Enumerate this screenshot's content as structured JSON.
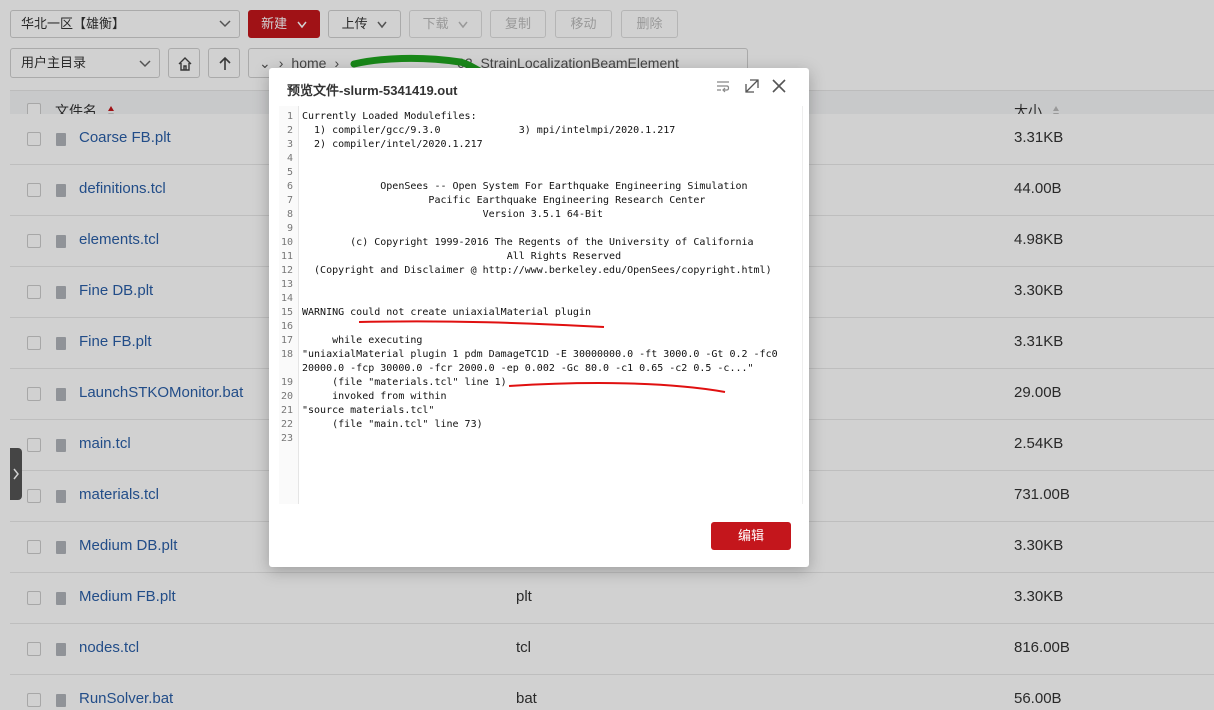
{
  "toolbar": {
    "region": "华北一区【雄衡】",
    "new_label": "新建",
    "upload_label": "上传",
    "download_label": "下载",
    "copy_label": "复制",
    "move_label": "移动",
    "delete_label": "删除",
    "dir_select": "用户主目录",
    "path_parts": [
      "home",
      "02_StrainLocalizationBeamElement"
    ]
  },
  "table": {
    "headers": {
      "name": "文件名",
      "size": "大小"
    },
    "rows": [
      {
        "name": "Coarse FB.plt",
        "type": "",
        "size": "3.31KB"
      },
      {
        "name": "definitions.tcl",
        "type": "",
        "size": "44.00B"
      },
      {
        "name": "elements.tcl",
        "type": "",
        "size": "4.98KB"
      },
      {
        "name": "Fine DB.plt",
        "type": "",
        "size": "3.30KB"
      },
      {
        "name": "Fine FB.plt",
        "type": "",
        "size": "3.31KB"
      },
      {
        "name": "LaunchSTKOMonitor.bat",
        "type": "",
        "size": "29.00B"
      },
      {
        "name": "main.tcl",
        "type": "",
        "size": "2.54KB"
      },
      {
        "name": "materials.tcl",
        "type": "",
        "size": "731.00B"
      },
      {
        "name": "Medium DB.plt",
        "type": "",
        "size": "3.30KB"
      },
      {
        "name": "Medium FB.plt",
        "type": "plt",
        "size": "3.30KB"
      },
      {
        "name": "nodes.tcl",
        "type": "tcl",
        "size": "816.00B"
      },
      {
        "name": "RunSolver.bat",
        "type": "bat",
        "size": "56.00B"
      }
    ]
  },
  "modal": {
    "title": "预览文件-slurm-5341419.out",
    "edit_label": "编辑",
    "lines": [
      {
        "n": "1",
        "text": "Currently Loaded Modulefiles:"
      },
      {
        "n": "2",
        "text": "  1) compiler/gcc/9.3.0             3) mpi/intelmpi/2020.1.217"
      },
      {
        "n": "3",
        "text": "  2) compiler/intel/2020.1.217"
      },
      {
        "n": "4",
        "text": ""
      },
      {
        "n": "5",
        "text": ""
      },
      {
        "n": "6",
        "text": "             OpenSees -- Open System For Earthquake Engineering Simulation"
      },
      {
        "n": "7",
        "text": "                     Pacific Earthquake Engineering Research Center"
      },
      {
        "n": "8",
        "text": "                              Version 3.5.1 64-Bit"
      },
      {
        "n": "9",
        "text": ""
      },
      {
        "n": "10",
        "text": "        (c) Copyright 1999-2016 The Regents of the University of California"
      },
      {
        "n": "11",
        "text": "                                  All Rights Reserved"
      },
      {
        "n": "12",
        "text": "  (Copyright and Disclaimer @ http://www.berkeley.edu/OpenSees/copyright.html)"
      },
      {
        "n": "13",
        "text": ""
      },
      {
        "n": "14",
        "text": ""
      },
      {
        "n": "15",
        "text": "WARNING could not create uniaxialMaterial plugin"
      },
      {
        "n": "16",
        "text": ""
      },
      {
        "n": "17",
        "text": "     while executing"
      },
      {
        "n": "18",
        "text": "\"uniaxialMaterial plugin 1 pdm DamageTC1D -E 30000000.0 -ft 3000.0 -Gt 0.2 -fc0"
      },
      {
        "n": "",
        "text": "20000.0 -fcp 30000.0 -fcr 2000.0 -ep 0.002 -Gc 80.0 -c1 0.65 -c2 0.5 -c...\""
      },
      {
        "n": "19",
        "text": "     (file \"materials.tcl\" line 1)"
      },
      {
        "n": "20",
        "text": "     invoked from within"
      },
      {
        "n": "21",
        "text": "\"source materials.tcl\""
      },
      {
        "n": "22",
        "text": "     (file \"main.tcl\" line 73)"
      },
      {
        "n": "23",
        "text": ""
      }
    ]
  }
}
